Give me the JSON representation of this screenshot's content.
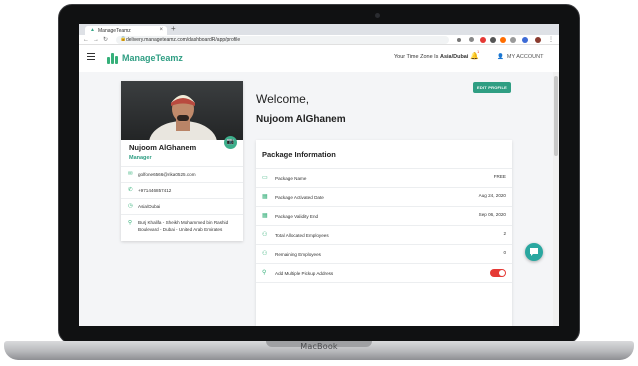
{
  "device": {
    "label": "MacBook"
  },
  "browser": {
    "tab_title": "ManageTeamz",
    "url": "delivery.manageteamz.com/dashboardR/app/profile"
  },
  "header": {
    "brand": "ManageTeamz",
    "timezone_prefix": "Your Time Zone Is",
    "timezone_value": "Asia/Dubai",
    "notification_badge": "1",
    "account_label": "MY ACCOUNT"
  },
  "profile": {
    "name": "Nujoom AlGhanem",
    "role": "Manager",
    "email": "golfone6566@rika0525.com",
    "phone": "+971446857412",
    "timezone": "Asia/Dubai",
    "address": "Burj Khalifa - Sheikh Mohammed bin Rashid Boulevard - Dubai - United Arab Emirates"
  },
  "welcome": {
    "greeting": "Welcome,",
    "name": "Nujoom AlGhanem",
    "edit_label": "EDIT PROFILE"
  },
  "package": {
    "title": "Package Information",
    "rows": [
      {
        "label": "Package Name",
        "value": "FREE"
      },
      {
        "label": "Package Activated Date",
        "value": "Aug 24, 2020"
      },
      {
        "label": "Package Validity End",
        "value": "Sep 06, 2020"
      },
      {
        "label": "Total Allocated Employees",
        "value": "2"
      },
      {
        "label": "Remaining Employees",
        "value": "0"
      },
      {
        "label": "Add Multiple Pickup Address",
        "value": ""
      }
    ],
    "toggle_on": false
  },
  "colors": {
    "brand": "#2f9e83",
    "accent": "#36b07a",
    "toggle": "#e53935",
    "chat": "#2aa7a0"
  }
}
